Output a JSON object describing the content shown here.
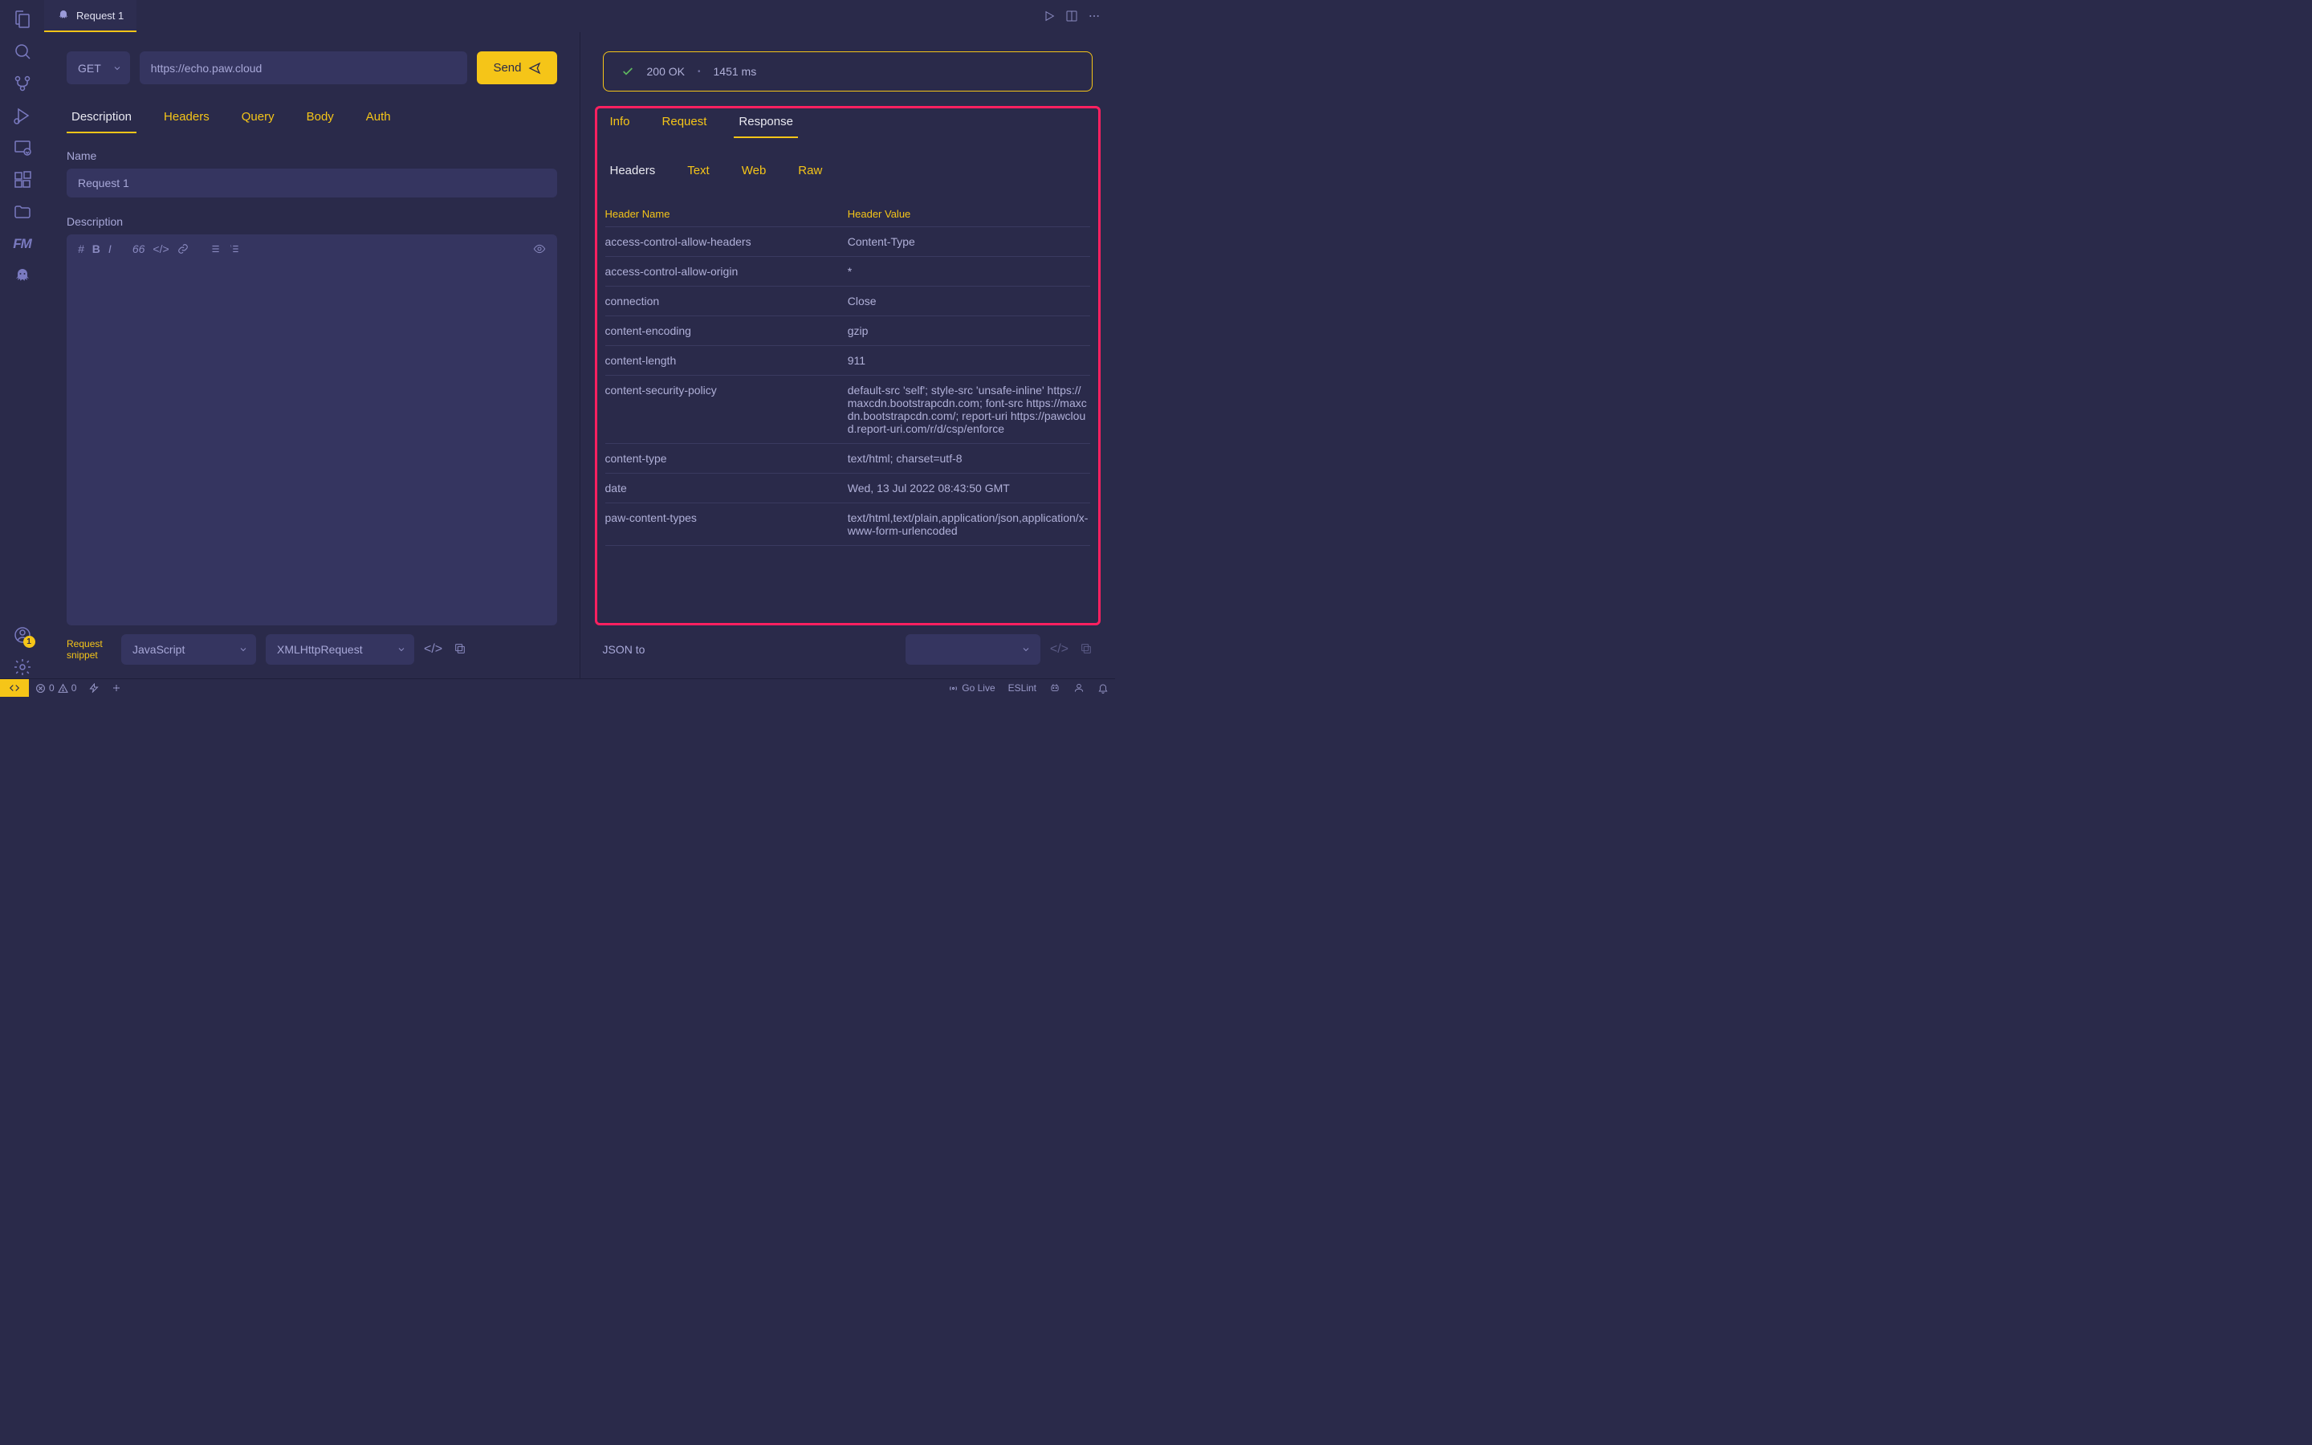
{
  "tab": {
    "title": "Request 1"
  },
  "request": {
    "method": "GET",
    "url": "https://echo.paw.cloud",
    "send_label": "Send"
  },
  "left_tabs": [
    "Description",
    "Headers",
    "Query",
    "Body",
    "Auth"
  ],
  "name_label": "Name",
  "name_value": "Request 1",
  "description_label": "Description",
  "snippet_label_1": "Request",
  "snippet_label_2": "snippet",
  "snippet_lang": "JavaScript",
  "snippet_lib": "XMLHttpRequest",
  "status": {
    "code": "200 OK",
    "time": "1451 ms"
  },
  "right_tabs": [
    "Info",
    "Request",
    "Response"
  ],
  "view_tabs": [
    "Headers",
    "Text",
    "Web",
    "Raw"
  ],
  "header_col1": "Header Name",
  "header_col2": "Header Value",
  "headers": [
    {
      "name": "access-control-allow-headers",
      "value": "Content-Type"
    },
    {
      "name": "access-control-allow-origin",
      "value": "*"
    },
    {
      "name": "connection",
      "value": "Close"
    },
    {
      "name": "content-encoding",
      "value": "gzip"
    },
    {
      "name": "content-length",
      "value": "911"
    },
    {
      "name": "content-security-policy",
      "value": "default-src 'self'; style-src 'unsafe-inline' https://maxcdn.bootstrapcdn.com; font-src https://maxcdn.bootstrapcdn.com/; report-uri https://pawcloud.report-uri.com/r/d/csp/enforce"
    },
    {
      "name": "content-type",
      "value": "text/html; charset=utf-8"
    },
    {
      "name": "date",
      "value": "Wed, 13 Jul 2022 08:43:50 GMT"
    },
    {
      "name": "paw-content-types",
      "value": "text/html,text/plain,application/json,application/x-www-form-urlencoded"
    }
  ],
  "json_to": "JSON to",
  "accounts_badge": "1",
  "statusbar": {
    "errors": "0",
    "warnings": "0",
    "golive": "Go Live",
    "eslint": "ESLint"
  }
}
